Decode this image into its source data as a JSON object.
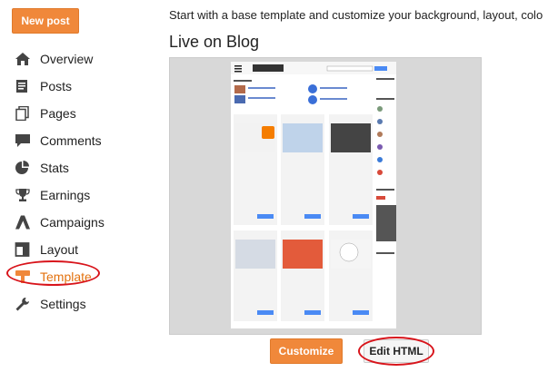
{
  "sidebar": {
    "new_post_label": "New post",
    "items": [
      {
        "label": "Overview",
        "icon": "home-icon"
      },
      {
        "label": "Posts",
        "icon": "posts-icon"
      },
      {
        "label": "Pages",
        "icon": "pages-icon"
      },
      {
        "label": "Comments",
        "icon": "comment-icon"
      },
      {
        "label": "Stats",
        "icon": "pie-chart-icon"
      },
      {
        "label": "Earnings",
        "icon": "trophy-icon"
      },
      {
        "label": "Campaigns",
        "icon": "adwords-icon"
      },
      {
        "label": "Layout",
        "icon": "layout-icon"
      },
      {
        "label": "Template",
        "icon": "template-icon",
        "active": true
      },
      {
        "label": "Settings",
        "icon": "wrench-icon"
      }
    ]
  },
  "main": {
    "intro_text": "Start with a base template and customize your background, layout, colo",
    "section_title": "Live on Blog",
    "customize_label": "Customize",
    "edit_html_label": "Edit HTML"
  },
  "colors": {
    "accent": "#f0883a",
    "active_text": "#e3720f",
    "annotation_red": "#d8141b"
  }
}
